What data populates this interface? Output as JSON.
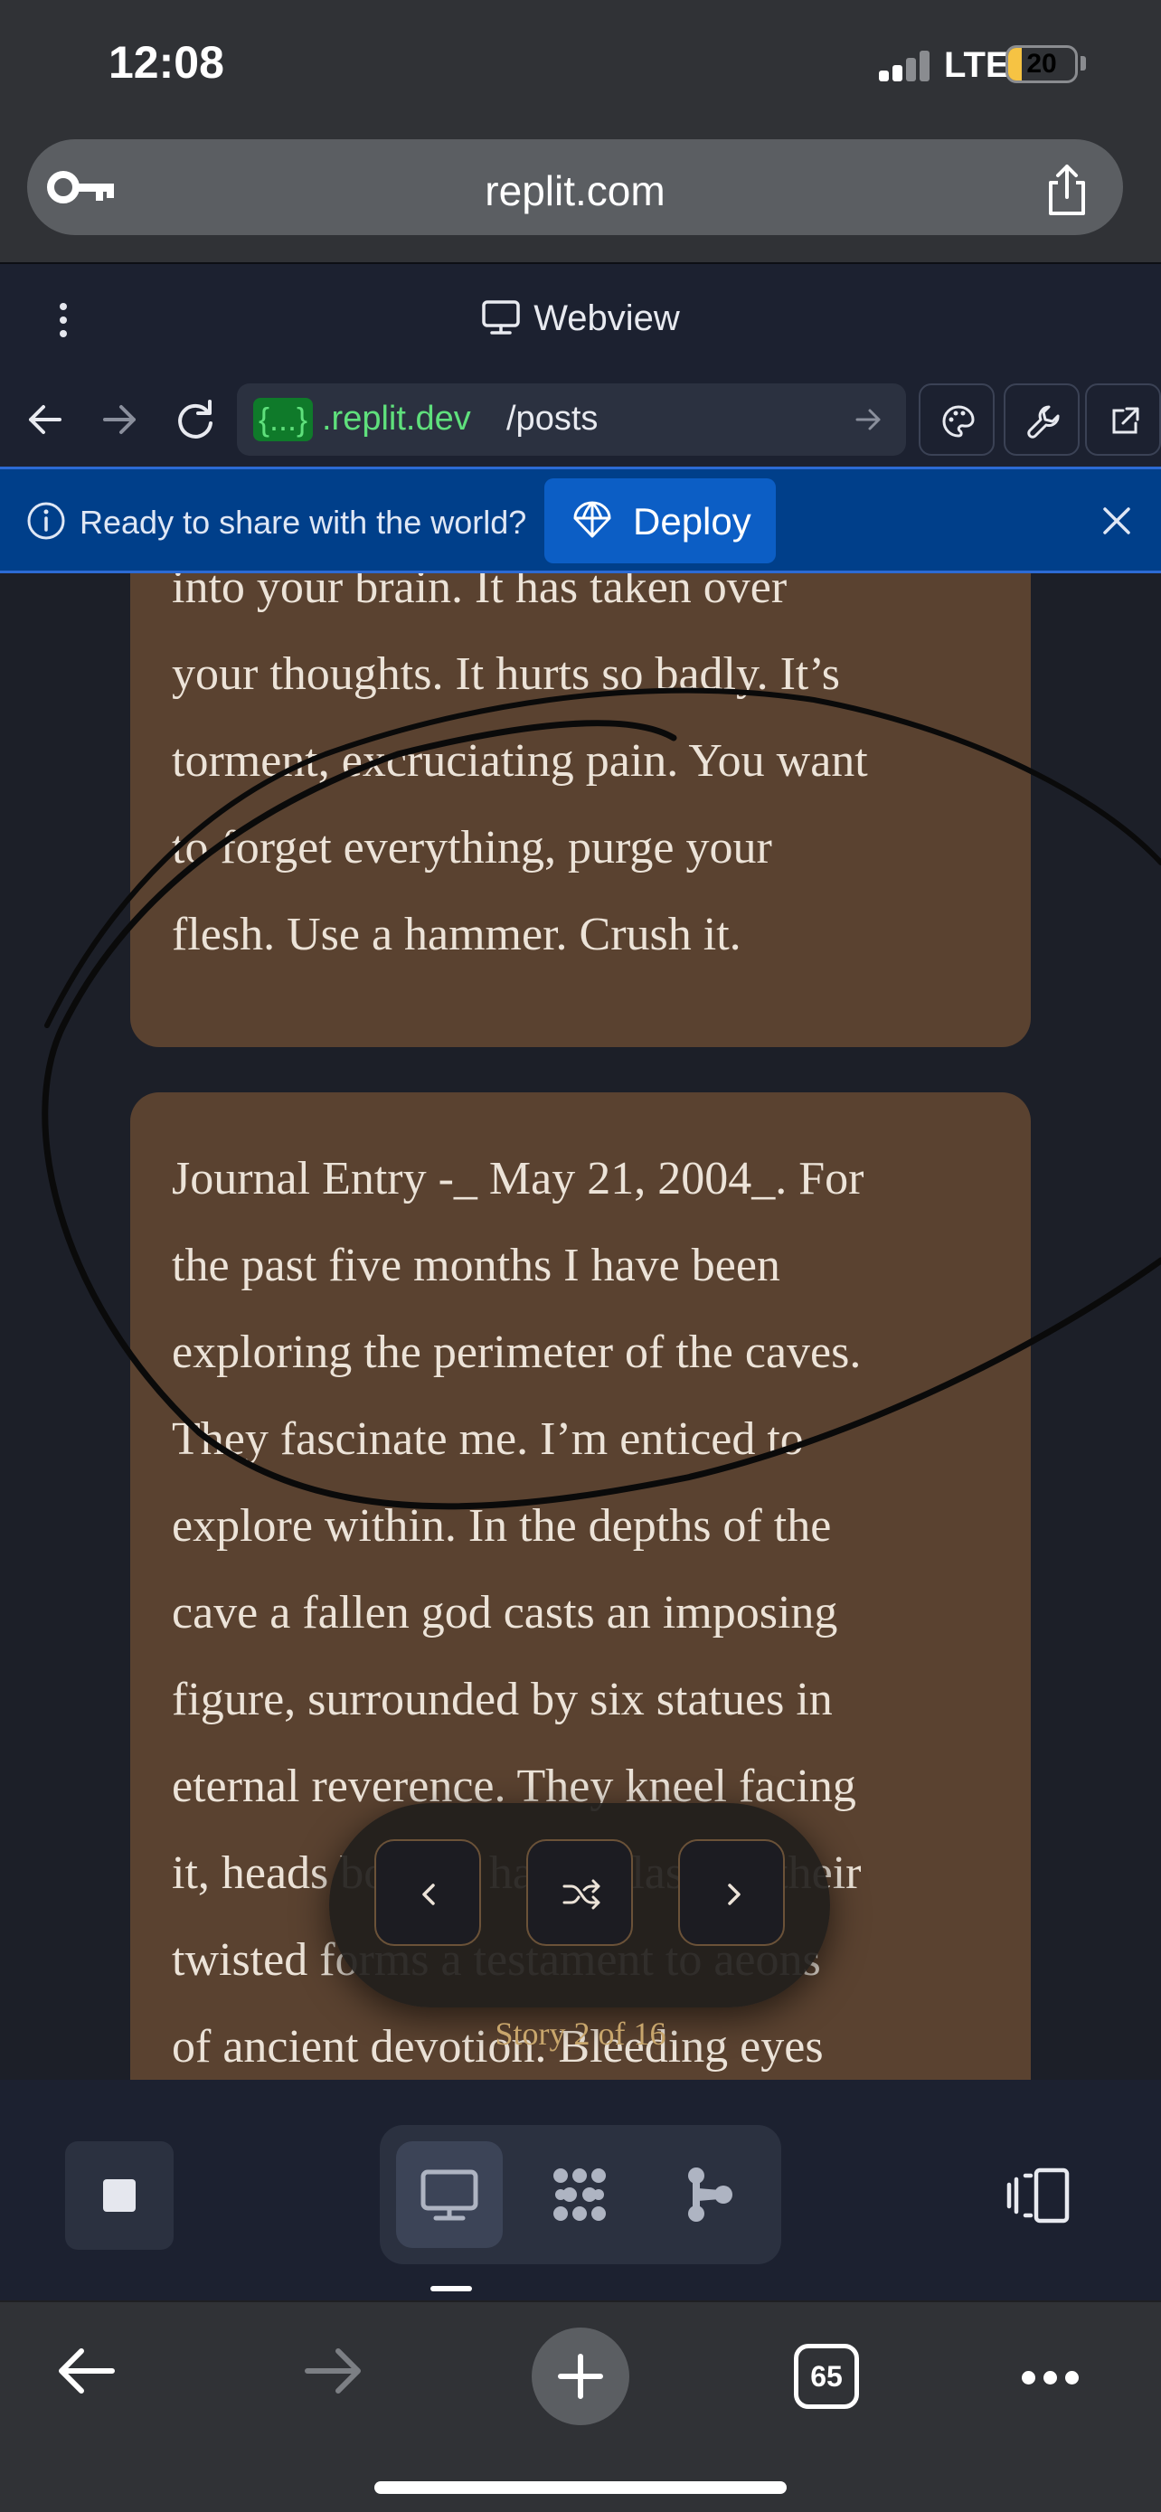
{
  "status_bar": {
    "time": "12:08",
    "network": "LTE",
    "battery": "20",
    "battery_level_percent": 20
  },
  "browser": {
    "address": "replit.com"
  },
  "replit": {
    "title": "Webview",
    "url_badge": "{...}",
    "url_domain": ".replit.dev",
    "url_path": "/posts"
  },
  "deploy_banner": {
    "message": "Ready to share with the world?",
    "button": "Deploy"
  },
  "stories": [
    {
      "lines": [
        "into your brain. It has taken over",
        "your thoughts. It hurts so badly. It’s",
        "torment, excruciating pain. You want",
        "to forget everything, purge your",
        "flesh. Use a hammer. Crush it."
      ]
    },
    {
      "lines": [
        "Journal Entry -_ May 21, 2004_. For",
        "the past five months I have been",
        "exploring the perimeter of the caves.",
        "They fascinate me. I’m enticed to",
        "explore within. In the depths of the",
        "cave a fallen god casts an imposing",
        "figure, surrounded by six statues in",
        "eternal reverence. They kneel facing",
        "it, heads bowed, hands clasped, their",
        "twisted forms a testament to aeons",
        "of ancient devotion. Bleeding eyes"
      ]
    }
  ],
  "story_nav": {
    "counter": "Story 2 of 16"
  },
  "safari": {
    "tab_count": "65"
  },
  "colors": {
    "card": "#5a4230",
    "deploy_banner": "#003f8a",
    "url_green": "#5fe07c",
    "accent_gold": "#c8a66c"
  }
}
